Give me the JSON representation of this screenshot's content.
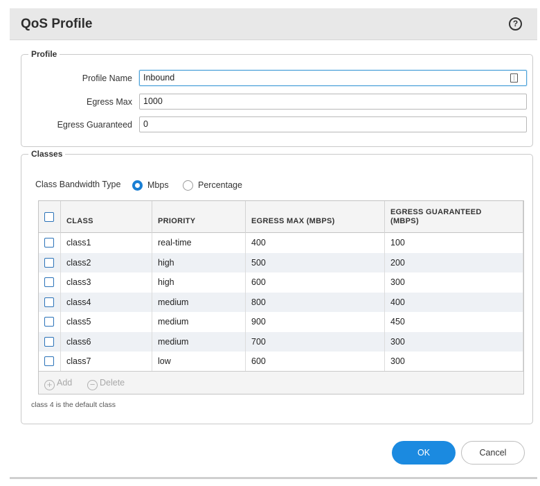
{
  "dialog": {
    "title": "QoS Profile",
    "help_icon": "help-icon"
  },
  "profile": {
    "legend": "Profile",
    "fields": [
      {
        "label": "Profile Name",
        "value": "Inbound"
      },
      {
        "label": "Egress Max",
        "value": "1000"
      },
      {
        "label": "Egress Guaranteed",
        "value": "0"
      }
    ]
  },
  "classes": {
    "legend": "Classes",
    "bandwidth_type_label": "Class Bandwidth Type",
    "options": [
      "Mbps",
      "Percentage"
    ],
    "selected_option": "Mbps",
    "columns": [
      "CLASS",
      "PRIORITY",
      "EGRESS MAX (MBPS)",
      "EGRESS GUARANTEED (MBPS)"
    ],
    "rows": [
      [
        "class1",
        "real-time",
        "400",
        "100"
      ],
      [
        "class2",
        "high",
        "500",
        "200"
      ],
      [
        "class3",
        "high",
        "600",
        "300"
      ],
      [
        "class4",
        "medium",
        "800",
        "400"
      ],
      [
        "class5",
        "medium",
        "900",
        "450"
      ],
      [
        "class6",
        "medium",
        "700",
        "300"
      ],
      [
        "class7",
        "low",
        "600",
        "300"
      ]
    ],
    "toolbar": {
      "add_label": "Add",
      "delete_label": "Delete"
    },
    "note": "class 4 is the default class"
  },
  "buttons": {
    "ok": "OK",
    "cancel": "Cancel"
  },
  "colors": {
    "accent": "#1b8ae0",
    "row_alt": "#eef1f5",
    "checkbox": "#2a72b8"
  }
}
